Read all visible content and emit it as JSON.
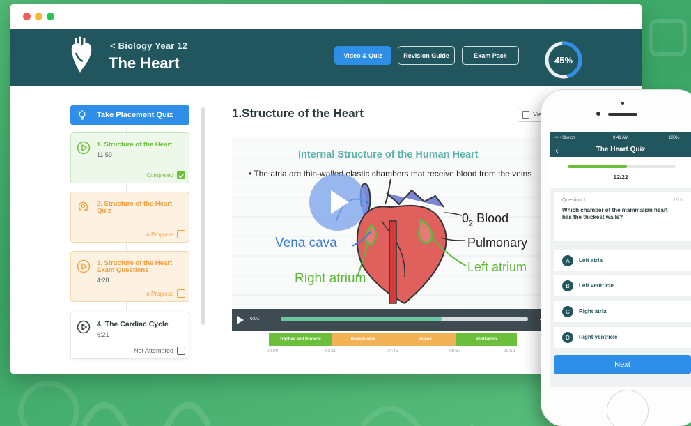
{
  "window": {
    "breadcrumb": "< Biology Year 12",
    "title": "The Heart",
    "tabs": [
      {
        "label": "Video & Quiz",
        "active": true
      },
      {
        "label": "Revision Guide",
        "active": false
      },
      {
        "label": "Exam Pack",
        "active": false
      }
    ],
    "progress": {
      "label": "45%",
      "value": 0.45
    }
  },
  "sidebar": {
    "placement_button": "Take Placement Quiz",
    "lessons": [
      {
        "title": "1. Structure of the Heart",
        "time": "11:59",
        "status": "Completed",
        "icon": "play-icon"
      },
      {
        "title": "2. Structure of the Heart Quiz",
        "time": "",
        "status": "In Progress",
        "icon": "lightbulb-icon"
      },
      {
        "title": "3. Structure of the Heart Exam Questions",
        "time": "4:28",
        "status": "In Progress",
        "icon": "play-icon"
      },
      {
        "title": "4. The Cardiac Cycle",
        "time": "6:21",
        "status": "Not Attempted",
        "icon": "play-icon"
      }
    ]
  },
  "main": {
    "section_title": "1.Structure of the Heart",
    "view_button": "Vie",
    "video": {
      "title": "Internal Structure of the Human Heart",
      "bullet": "The atria are thin-walled elastic chambers that receive blood from the veins",
      "labels": {
        "vena_cava": "Vena cava",
        "right_atrium": "Right atrium",
        "o2_prefix": "0",
        "o2_sub": "2",
        "o2_word": "Blood",
        "pulmonary": "Pulmonary",
        "left_atrium": "Left atrium"
      },
      "current_time": "6:01",
      "played_fraction": 0.65
    },
    "chapters": [
      {
        "label": "Trachea and Bronchi",
        "color": "#6cbf3b"
      },
      {
        "label": "Bronchioles",
        "color": "#f2b155"
      },
      {
        "label": "Alveoli",
        "color": "#f2b155"
      },
      {
        "label": "Ventilation",
        "color": "#6cbf3b"
      }
    ],
    "chapter_times": [
      "00:00",
      "02:10",
      "04:45",
      "06:37",
      "09:52"
    ]
  },
  "phone": {
    "status": {
      "carrier": "••••• Sketch",
      "time": "9:41 AM",
      "battery": "100%"
    },
    "nav_title": "The Heart Quiz",
    "progress": {
      "label": "12/22",
      "value": 0.55
    },
    "question_label": "Question 1",
    "question_num": "1/10",
    "question": "Which chamber of the mammalian heart has the thickest walls?",
    "options": [
      {
        "letter": "A",
        "text": "Left atria"
      },
      {
        "letter": "B",
        "text": "Left ventricle"
      },
      {
        "letter": "C",
        "text": "Right atria"
      },
      {
        "letter": "D",
        "text": "Right ventricle"
      }
    ],
    "next": "Next"
  },
  "colors": {
    "header": "#21565f",
    "accent": "#2e8ee8",
    "complete": "#6cbf3b",
    "in_progress": "#f0a043"
  }
}
